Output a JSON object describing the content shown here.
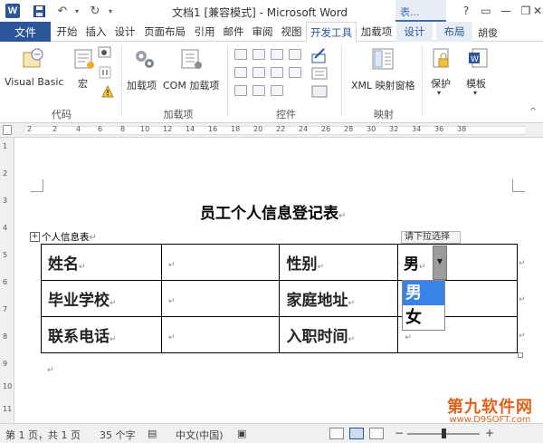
{
  "titlebar": {
    "logo": "W",
    "title": "文档1 [兼容模式] - Microsoft Word",
    "context_group": "表...",
    "help": "?",
    "minimize": "—",
    "restore": "❐",
    "close": "✕"
  },
  "tabs": {
    "file": "文件",
    "items": [
      "开始",
      "插入",
      "设计",
      "页面布局",
      "引用",
      "邮件",
      "审阅",
      "视图",
      "开发工具",
      "加载项"
    ],
    "active": "开发工具",
    "context_items": [
      "设计",
      "布局"
    ],
    "user": "胡俊"
  },
  "ribbon": {
    "groups": [
      {
        "label": "代码",
        "buttons": [
          "Visual Basic",
          "宏"
        ]
      },
      {
        "label": "加载项",
        "buttons": [
          "加载项",
          "COM 加载项"
        ]
      },
      {
        "label": "控件",
        "buttons": []
      },
      {
        "label": "映射",
        "buttons": [
          "XML 映射窗格"
        ]
      },
      {
        "label": "",
        "buttons": [
          "保护",
          "模板"
        ]
      }
    ]
  },
  "ruler": {
    "numbers": [
      "2",
      "2",
      "4",
      "6",
      "8",
      "10",
      "12",
      "14",
      "16",
      "18",
      "20",
      "22",
      "24",
      "26",
      "28",
      "30",
      "32",
      "34",
      "36",
      "38"
    ],
    "v_numbers": [
      "1",
      "2",
      "3",
      "4",
      "5",
      "6",
      "7",
      "8",
      "9",
      "10",
      "11"
    ]
  },
  "document": {
    "heading": "员工个人信息登记表",
    "paragraph_mark": "↵",
    "table_caption": "个人信息表",
    "table_rows": [
      {
        "label1": "姓名",
        "value1": "",
        "label2": "性别",
        "value2": "男"
      },
      {
        "label1": "毕业学校",
        "value1": "",
        "label2": "家庭地址",
        "value2": ""
      },
      {
        "label1": "联系电话",
        "value1": "",
        "label2": "入职时间",
        "value2": ""
      }
    ],
    "dropdown": {
      "tag": "请下拉选择",
      "value": "男",
      "options": [
        "男",
        "女"
      ],
      "highlighted": "男"
    }
  },
  "watermark": {
    "line1": "第九软件网",
    "line2": "www.D9SOFT.com"
  },
  "status": {
    "page": "第 1 页，共 1 页",
    "words": "35 个字",
    "language": "中文(中国)",
    "zoom_minus": "−",
    "zoom_plus": "+"
  }
}
